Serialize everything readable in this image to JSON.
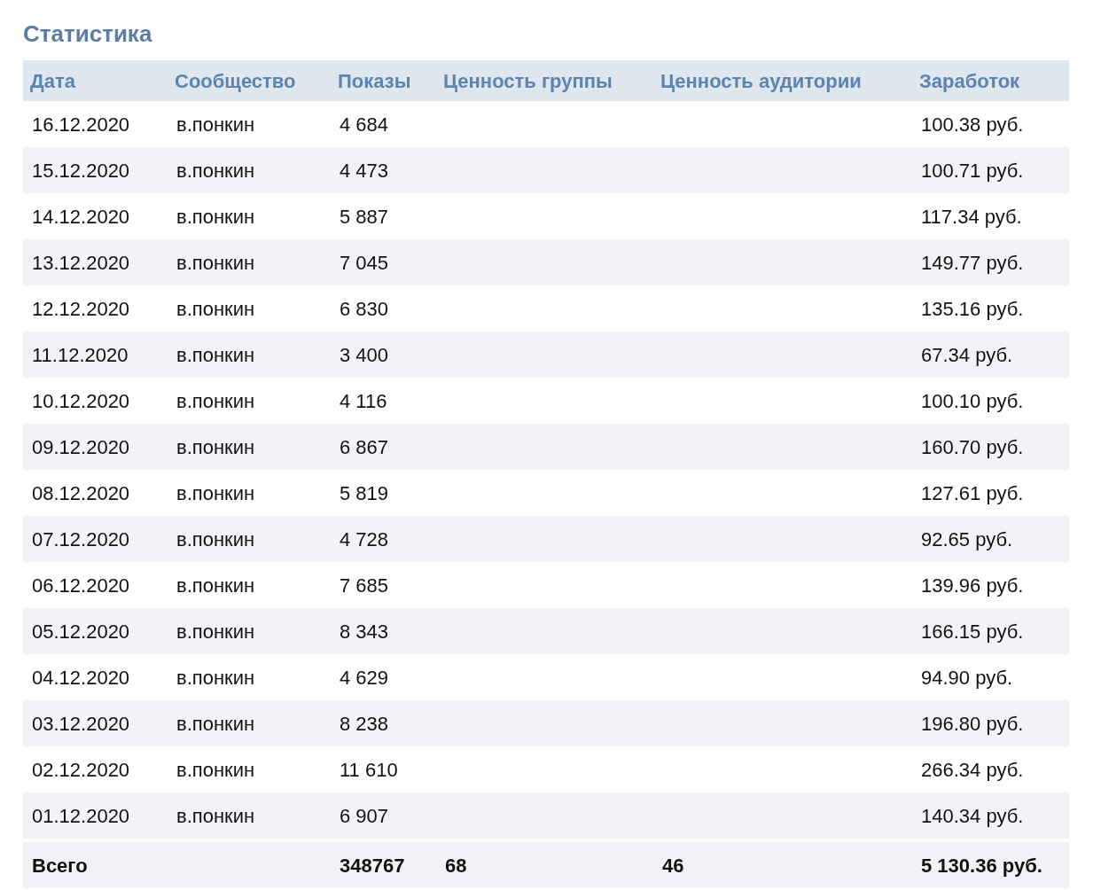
{
  "title": "Статистика",
  "table": {
    "columns": [
      "Дата",
      "Сообщество",
      "Показы",
      "Ценность группы",
      "Ценность аудитории",
      "Заработок"
    ],
    "rows": [
      {
        "date": "16.12.2020",
        "community": "в.понкин",
        "views": "4 684",
        "earnings": "100.38 руб."
      },
      {
        "date": "15.12.2020",
        "community": "в.понкин",
        "views": "4 473",
        "earnings": "100.71 руб."
      },
      {
        "date": "14.12.2020",
        "community": "в.понкин",
        "views": "5 887",
        "earnings": "117.34 руб."
      },
      {
        "date": "13.12.2020",
        "community": "в.понкин",
        "views": "7 045",
        "earnings": "149.77 руб."
      },
      {
        "date": "12.12.2020",
        "community": "в.понкин",
        "views": "6 830",
        "earnings": "135.16 руб."
      },
      {
        "date": "11.12.2020",
        "community": "в.понкин",
        "views": "3 400",
        "earnings": "67.34 руб."
      },
      {
        "date": "10.12.2020",
        "community": "в.понкин",
        "views": "4 116",
        "earnings": "100.10 руб."
      },
      {
        "date": "09.12.2020",
        "community": "в.понкин",
        "views": "6 867",
        "earnings": "160.70 руб."
      },
      {
        "date": "08.12.2020",
        "community": "в.понкин",
        "views": "5 819",
        "earnings": "127.61 руб."
      },
      {
        "date": "07.12.2020",
        "community": "в.понкин",
        "views": "4 728",
        "earnings": "92.65 руб."
      },
      {
        "date": "06.12.2020",
        "community": "в.понкин",
        "views": "7 685",
        "earnings": "139.96 руб."
      },
      {
        "date": "05.12.2020",
        "community": "в.понкин",
        "views": "8 343",
        "earnings": "166.15 руб."
      },
      {
        "date": "04.12.2020",
        "community": "в.понкин",
        "views": "4 629",
        "earnings": "94.90 руб."
      },
      {
        "date": "03.12.2020",
        "community": "в.понкин",
        "views": "8 238",
        "earnings": "196.80 руб."
      },
      {
        "date": "02.12.2020",
        "community": "в.понкин",
        "views": "11 610",
        "earnings": "266.34 руб."
      },
      {
        "date": "01.12.2020",
        "community": "в.понкин",
        "views": "6 907",
        "earnings": "140.34 руб."
      }
    ],
    "total": {
      "date": "Всего",
      "views": "348767",
      "group_value": "68",
      "audience_value": "46",
      "earnings": "5 130.36 руб."
    }
  }
}
